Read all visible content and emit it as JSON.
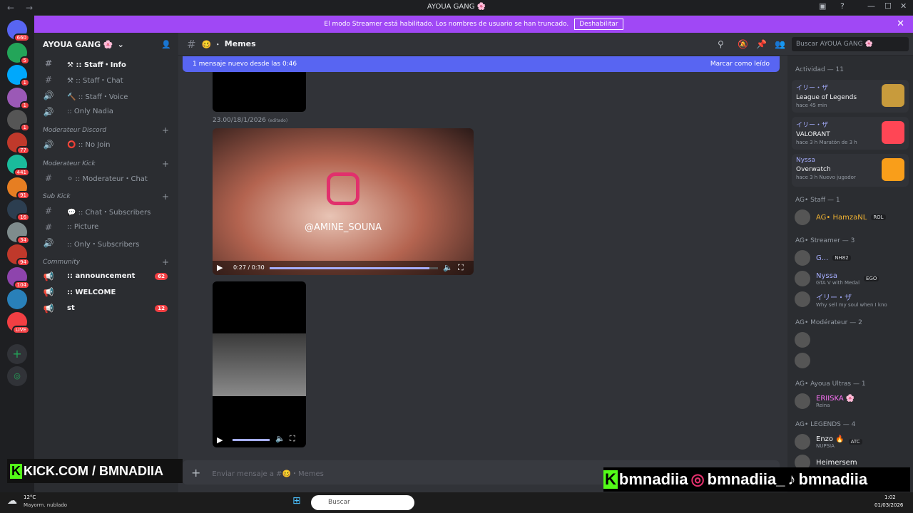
{
  "window": {
    "title": "AYOUA GANG 🌸",
    "back": "←",
    "forward": "→"
  },
  "banner": {
    "text": "El modo Streamer está habilitado. Los nombres de usuario se han truncado.",
    "button": "Deshabilitar",
    "close": "✕"
  },
  "guilds": [
    {
      "badge": "660"
    },
    {
      "badge": "5"
    },
    {
      "badge": "1"
    },
    {
      "badge": "1"
    },
    {
      "badge": "1"
    },
    {
      "badge": "77"
    },
    {
      "badge": "441"
    },
    {
      "badge": "91"
    },
    {
      "badge": "16"
    },
    {
      "badge": "34"
    },
    {
      "badge": "94"
    },
    {
      "badge": "104"
    },
    {
      "badge": ""
    },
    {
      "badge": "LIVE"
    }
  ],
  "server": {
    "name": "AYOUA GANG 🌸"
  },
  "channels": [
    {
      "icon": "#",
      "label": "⚒ ꞉꞉ Staff・Info",
      "bright": true
    },
    {
      "icon": "#",
      "label": "⚒ ꞉꞉ Staff・Chat"
    },
    {
      "icon": "🔊",
      "label": "🔨 ꞉꞉ Staff・Voice"
    },
    {
      "icon": "🔊",
      "label": "꞉꞉ Only Nadia"
    },
    {
      "cat": "Moderateur Discord"
    },
    {
      "icon": "🔊",
      "label": "⭕ ꞉꞉ No Join"
    },
    {
      "cat": "Moderateur Kick"
    },
    {
      "icon": "#",
      "label": "⚪ ꞉꞉ Moderateur・Chat"
    },
    {
      "cat": "Sub Kick"
    },
    {
      "icon": "#",
      "label": "💬 ꞉꞉ Chat・Subscribers"
    },
    {
      "icon": "#",
      "label": "꞉꞉ Picture"
    },
    {
      "icon": "🔊",
      "label": "꞉꞉ Only・Subscribers"
    },
    {
      "cat": "Community"
    },
    {
      "icon": "📢",
      "label": "꞉꞉ announcement",
      "bright": true,
      "unread": "62"
    },
    {
      "icon": "📢",
      "label": "꞉꞉ WELCOME",
      "bright": true
    },
    {
      "icon": "📢",
      "label": "st",
      "bright": true,
      "unread": "12"
    }
  ],
  "channel": {
    "name": "Memes",
    "composer": "Enviar mensaje a #🥴・Memes"
  },
  "search": {
    "placeholder": "Buscar AYOUA GANG 🌸"
  },
  "newbar": {
    "text": "1 mensaje nuevo desde las 0:46",
    "mark": "Marcar como leído"
  },
  "message": {
    "timestamp": "23.00/18/1/2026",
    "edited": "(editado)",
    "video1": {
      "handle": "@AMINE_SOUNA",
      "time": "0:27 / 0:30",
      "progress": 0.95
    }
  },
  "members": {
    "activity_title": "Actividad — 11",
    "activities": [
      {
        "user": "イリー・ザ",
        "game": "League of Legends",
        "time": "hace 45 min",
        "color": "#c89b3c"
      },
      {
        "user": "イリー・ザ",
        "game": "VALORANT",
        "time": "hace 3 h   Maratón de 3 h",
        "color": "#ff4655"
      },
      {
        "user": "Nyssa",
        "game": "Overwatch",
        "time": "hace 3 h   Nuevo jugador",
        "color": "#f99e1a"
      }
    ],
    "groups": [
      {
        "title": "AG• Staff — 1",
        "items": [
          {
            "name": "AG• HamzaNL",
            "tag": "ROL",
            "color": "#f0b232",
            "sub": ""
          }
        ]
      },
      {
        "title": "AG• Streamer — 3",
        "items": [
          {
            "name": "G...",
            "tag": "NH82",
            "color": "#a6aeff",
            "sub": ""
          },
          {
            "name": "Nyssa",
            "tag": "EGO",
            "color": "#a6aeff",
            "sub": "GTA V with Medal"
          },
          {
            "name": "イリー・ザ",
            "tag": "",
            "color": "#a6aeff",
            "sub": "Why sell my soul when I kno"
          }
        ]
      },
      {
        "title": "AG• Modérateur — 2",
        "items": [
          {
            "name": "",
            "tag": "",
            "color": "#8a4bff",
            "sub": ""
          },
          {
            "name": "",
            "tag": "",
            "color": "#8a4bff",
            "sub": ""
          }
        ]
      },
      {
        "title": "AG• Ayoua Ultras — 1",
        "items": [
          {
            "name": "ERIISKA 🌸",
            "tag": "",
            "color": "#ff73fa",
            "sub": "Reina"
          }
        ]
      },
      {
        "title": "AG• LEGENDS — 4",
        "items": [
          {
            "name": "Enzo 🔥",
            "tag": "ATC",
            "color": "#f2f3f5",
            "sub": "NUPSIA"
          },
          {
            "name": "Heimersem",
            "tag": "",
            "color": "#f2f3f5",
            "sub": ""
          }
        ]
      }
    ]
  },
  "overlay": {
    "kick": "KICK.COM / BMNADIIA",
    "social1": "bmnadiia",
    "social2": "bmnadiia_",
    "social3": "bmnadiia"
  },
  "taskbar": {
    "weather_temp": "12°C",
    "weather_desc": "Mayorm. nublado",
    "search": "Buscar",
    "time": "1:02",
    "date": "01/03/2026"
  }
}
